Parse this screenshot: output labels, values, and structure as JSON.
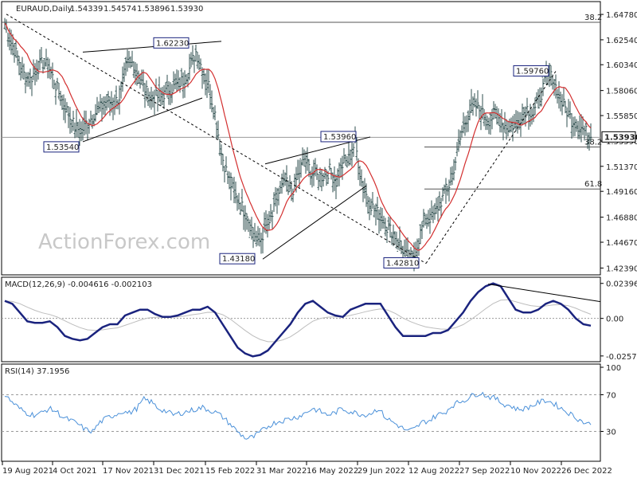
{
  "chart_data": [
    {
      "type": "candlestick",
      "title": "EURAUD,Daily",
      "ohlc": [
        1.54339,
        1.54574,
        1.53896,
        1.5393
      ],
      "ylim": [
        1.42,
        1.657
      ],
      "yticks": [
        1.6478,
        1.6254,
        1.6034,
        1.5806,
        1.5585,
        1.5359,
        1.5137,
        1.4916,
        1.4688,
        1.4467,
        1.4239
      ],
      "yticklabels": [
        "1.64780",
        "1.62540",
        "1.60340",
        "1.58060",
        "1.55850",
        "1.53590",
        "1.51370",
        "1.49160",
        "1.46880",
        "1.44670",
        "1.42390"
      ],
      "last_price": 1.5393,
      "last_price_label": "1.53930",
      "xticklabels": [
        "19 Aug 2021",
        "4 Oct 2021",
        "17 Nov 2021",
        "31 Dec 2021",
        "15 Feb 2022",
        "31 Mar 2022",
        "16 May 2022",
        "29 Jun 2022",
        "12 Aug 2022",
        "27 Sep 2022",
        "10 Nov 2022",
        "26 Dec 2022"
      ],
      "close_path": [
        1.64,
        1.623,
        1.61,
        1.595,
        1.59,
        1.6,
        1.605,
        1.6,
        1.585,
        1.572,
        1.56,
        1.548,
        1.545,
        1.552,
        1.56,
        1.565,
        1.572,
        1.568,
        1.575,
        1.6,
        1.605,
        1.595,
        1.58,
        1.575,
        1.575,
        1.578,
        1.582,
        1.585,
        1.59,
        1.6,
        1.615,
        1.6,
        1.585,
        1.56,
        1.525,
        1.505,
        1.49,
        1.48,
        1.47,
        1.455,
        1.447,
        1.46,
        1.47,
        1.49,
        1.5,
        1.49,
        1.505,
        1.52,
        1.51,
        1.505,
        1.505,
        1.51,
        1.5,
        1.515,
        1.52,
        1.535,
        1.5,
        1.485,
        1.475,
        1.47,
        1.46,
        1.455,
        1.445,
        1.435,
        1.43,
        1.45,
        1.47,
        1.468,
        1.478,
        1.488,
        1.5,
        1.525,
        1.55,
        1.563,
        1.567,
        1.56,
        1.555,
        1.56,
        1.552,
        1.548,
        1.55,
        1.558,
        1.565,
        1.56,
        1.575,
        1.59,
        1.593,
        1.575,
        1.565,
        1.555,
        1.55,
        1.545,
        1.5393
      ],
      "ma_label": "moving average",
      "annotations": [
        "1.62230",
        "1.53540",
        "1.53960",
        "1.43180",
        "1.42810",
        "1.59760"
      ],
      "fib_labels": [
        "38.2",
        "38.2",
        "61.8"
      ],
      "colors": {
        "bars": "#2f4f4f",
        "ma": "#d32f2f",
        "trend": "#000000",
        "annotation_border": "#1a237e"
      }
    },
    {
      "type": "line",
      "title": "MACD(12,26,9) -0.004616 -0.002103",
      "ylim": [
        -0.028,
        0.026
      ],
      "yticklabels": [
        "0.023963",
        "0.00",
        "-0.025726"
      ],
      "macd": [
        0.012,
        0.01,
        0.004,
        -0.002,
        -0.003,
        -0.003,
        -0.002,
        -0.006,
        -0.012,
        -0.014,
        -0.015,
        -0.014,
        -0.01,
        -0.006,
        -0.004,
        -0.004,
        0.002,
        0.004,
        0.006,
        0.006,
        0.003,
        0.001,
        0.001,
        0.002,
        0.004,
        0.006,
        0.006,
        0.008,
        0.004,
        -0.004,
        -0.012,
        -0.02,
        -0.024,
        -0.026,
        -0.025,
        -0.022,
        -0.016,
        -0.01,
        -0.004,
        0.004,
        0.01,
        0.012,
        0.008,
        0.004,
        0.002,
        0.001,
        0.006,
        0.008,
        0.01,
        0.01,
        0.01,
        0.002,
        -0.006,
        -0.012,
        -0.012,
        -0.012,
        -0.012,
        -0.01,
        -0.01,
        -0.008,
        -0.002,
        0.004,
        0.012,
        0.018,
        0.022,
        0.024,
        0.022,
        0.014,
        0.006,
        0.004,
        0.004,
        0.006,
        0.01,
        0.012,
        0.01,
        0.006,
        0.0,
        -0.004,
        -0.005
      ],
      "colors": {
        "macd": "#1a237e",
        "signal": "#bdbdbd",
        "trend": "#000000"
      }
    },
    {
      "type": "line",
      "title": "RSI(14) 37.1956",
      "ylim": [
        0,
        100
      ],
      "yticklabels": [
        "100",
        "70",
        "30",
        "0"
      ],
      "rsi": [
        70,
        62,
        55,
        50,
        48,
        50,
        55,
        52,
        45,
        42,
        38,
        32,
        30,
        40,
        45,
        48,
        52,
        50,
        55,
        65,
        62,
        55,
        52,
        48,
        50,
        52,
        54,
        56,
        53,
        50,
        44,
        36,
        28,
        22,
        24,
        30,
        36,
        40,
        42,
        44,
        46,
        50,
        55,
        52,
        48,
        50,
        55,
        52,
        50,
        48,
        50,
        55,
        45,
        40,
        35,
        30,
        33,
        40,
        42,
        48,
        50,
        58,
        62,
        65,
        70,
        72,
        68,
        66,
        60,
        58,
        54,
        55,
        58,
        62,
        64,
        60,
        55,
        50,
        45,
        40,
        37.1956
      ],
      "colors": {
        "rsi": "#4a90d9"
      }
    }
  ],
  "watermark": "ActionForex.com"
}
